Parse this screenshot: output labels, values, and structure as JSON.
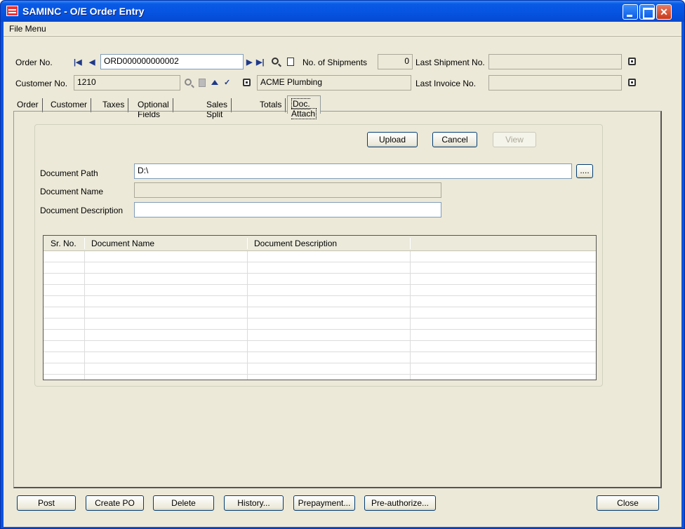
{
  "window": {
    "title": "SAMINC - O/E Order Entry"
  },
  "menu": {
    "file": "File Menu"
  },
  "header": {
    "order_no_label": "Order No.",
    "order_no_value": "ORD000000000002",
    "no_of_shipments_label": "No. of Shipments",
    "no_of_shipments_value": "0",
    "last_shipment_label": "Last Shipment No.",
    "last_shipment_value": "",
    "customer_no_label": "Customer No.",
    "customer_no_value": "1210",
    "customer_name_value": "ACME Plumbing",
    "last_invoice_label": "Last Invoice No.",
    "last_invoice_value": ""
  },
  "tabs": [
    {
      "label": "Order"
    },
    {
      "label": "Customer"
    },
    {
      "label": "Taxes"
    },
    {
      "label": "Optional Fields"
    },
    {
      "label": "Sales Split"
    },
    {
      "label": "Totals"
    },
    {
      "label": "Doc. Attach"
    }
  ],
  "doc_attach": {
    "upload_label": "Upload",
    "cancel_label": "Cancel",
    "view_label": "View",
    "document_path_label": "Document Path",
    "document_path_value": "D:\\",
    "browse_label": "....",
    "document_name_label": "Document Name",
    "document_name_value": "",
    "document_description_label": "Document Description",
    "document_description_value": "",
    "grid": {
      "columns": [
        "Sr. No.",
        "Document Name",
        "Document Description"
      ],
      "rows": []
    }
  },
  "footer": {
    "post": "Post",
    "create_po": "Create PO",
    "delete": "Delete",
    "history": "History...",
    "prepayment": "Prepayment...",
    "preauthorize": "Pre-authorize...",
    "close": "Close"
  }
}
